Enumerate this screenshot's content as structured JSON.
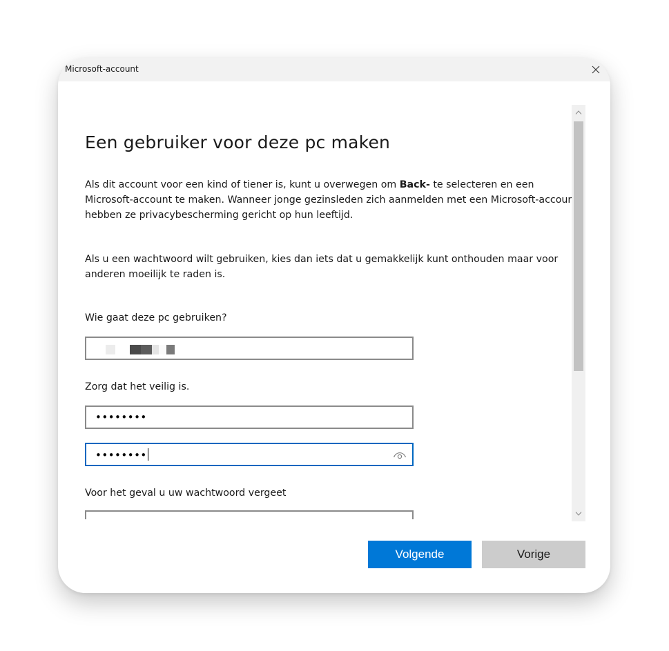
{
  "window": {
    "title": "Microsoft-account",
    "close_glyph": "×"
  },
  "page": {
    "heading": "Een gebruiker voor deze pc maken",
    "para1_before": "Als dit account voor een kind of tiener is, kunt u overwegen om ",
    "para1_bold": "Back-",
    "para1_after": " te selecteren en een Microsoft-account te maken. Wanneer jonge gezinsleden zich aanmelden met een Microsoft-account, hebben ze privacybescherming gericht op hun leeftijd.",
    "para2": "Als u een wachtwoord wilt gebruiken, kies dan iets dat u gemakkelijk kunt onthouden maar voor anderen moeilijk te raden is."
  },
  "form": {
    "name_label": "Wie gaat deze pc gebruiken?",
    "password_label": "Zorg dat het veilig is.",
    "password_masked": "••••••••",
    "confirm_masked": "••••••••",
    "hint_label": "Voor het geval u uw wachtwoord vergeet"
  },
  "buttons": {
    "next": "Volgende",
    "back": "Vorige"
  },
  "colors": {
    "accent": "#0078d7",
    "focus_border": "#0067c0",
    "secondary_button": "#cccccc"
  },
  "icons": {
    "close": "close-icon",
    "reveal_password": "eye-icon",
    "scroll_up": "chevron-up-icon",
    "scroll_down": "chevron-down-icon"
  }
}
